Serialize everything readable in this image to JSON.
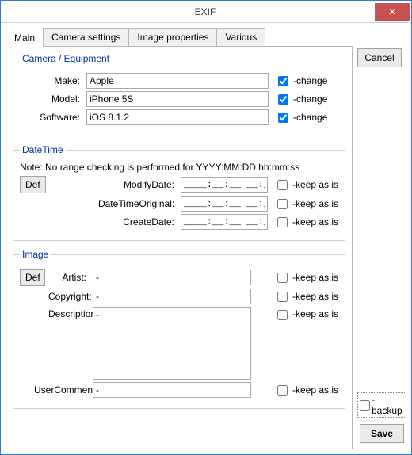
{
  "title": "EXIF",
  "close_glyph": "✕",
  "tabs": {
    "main": "Main",
    "camera": "Camera settings",
    "image": "Image properties",
    "various": "Various"
  },
  "camera_group": {
    "legend": "Camera / Equipment",
    "make_label": "Make:",
    "make_value": "Apple",
    "make_change_checked": true,
    "model_label": "Model:",
    "model_value": "iPhone 5S",
    "model_change_checked": true,
    "software_label": "Software:",
    "software_value": "iOS 8.1.2",
    "software_change_checked": true,
    "change_label": "-change"
  },
  "datetime_group": {
    "legend": "DateTime",
    "note": "Note: No range checking is performed for YYYY:MM:DD hh:mm:ss",
    "def_button": "Def",
    "modify_label": "ModifyDate:",
    "modify_value": "____:__:__ __:__:__",
    "orig_label": "DateTimeOriginal:",
    "orig_value": "____:__:__ __:__:__",
    "create_label": "CreateDate:",
    "create_value": "____:__:__ __:__:__",
    "keep_label": "-keep as is",
    "modify_keep_checked": false,
    "orig_keep_checked": false,
    "create_keep_checked": false
  },
  "image_group": {
    "legend": "Image",
    "def_button": "Def",
    "artist_label": "Artist:",
    "artist_value": "-",
    "artist_keep_checked": false,
    "copyright_label": "Copyright:",
    "copyright_value": "-",
    "copyright_keep_checked": false,
    "description_label": "Description:",
    "description_value": "-",
    "description_keep_checked": false,
    "usercomment_label": "UserComment:",
    "usercomment_value": "-",
    "usercomment_keep_checked": false,
    "keep_label": "-keep as is"
  },
  "buttons": {
    "cancel": "Cancel",
    "save": "Save",
    "backup": "-backup"
  },
  "backup_checked": false
}
